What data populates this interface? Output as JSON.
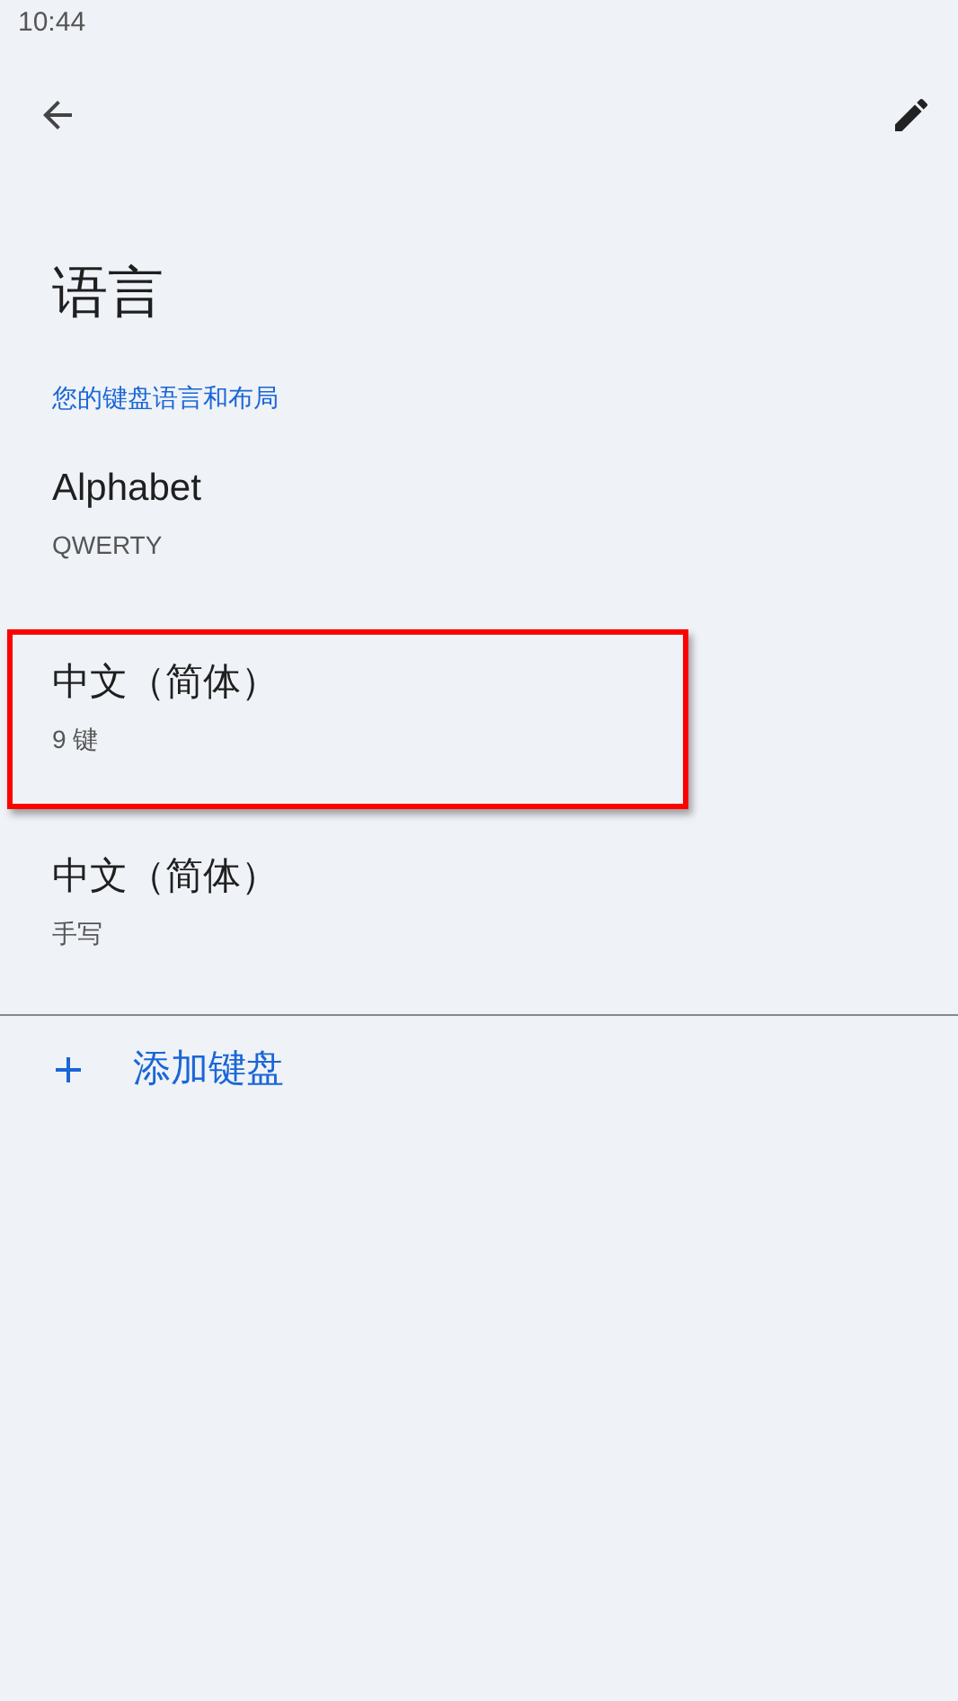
{
  "status_bar": {
    "time": "10:44"
  },
  "title": "语言",
  "section": "您的键盘语言和布局",
  "keyboards": [
    {
      "name": "Alphabet",
      "layout": "QWERTY",
      "highlighted": false
    },
    {
      "name": "中文（简体）",
      "layout": "9 键",
      "highlighted": true
    },
    {
      "name": "中文（简体）",
      "layout": "手写",
      "highlighted": false
    }
  ],
  "add_button": {
    "label": "添加键盘"
  }
}
